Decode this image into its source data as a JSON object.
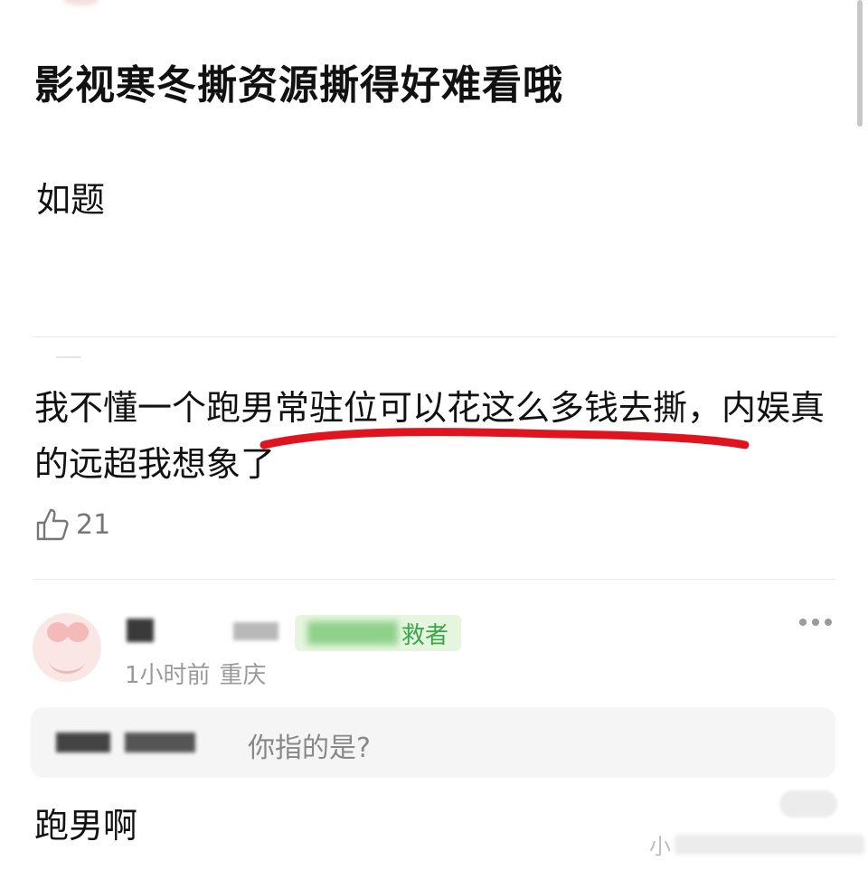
{
  "post": {
    "title": "影视寒冬撕资源撕得好难看哦",
    "body": "如题"
  },
  "comment": {
    "text": "我不懂一个跑男常驻位可以花这么多钱去撕，内娱真的远超我想象了",
    "likes": "21",
    "underline_color": "#e0141e"
  },
  "reply": {
    "badge_visible_text": "救者",
    "time": "1小时前",
    "location": "重庆",
    "quote_text": "你指的是?",
    "text": "跑男啊"
  },
  "watermark": {
    "visible_char": "小"
  },
  "colors": {
    "badge_text": "#3aa84a",
    "badge_bg": "#e6f6de",
    "meta": "#9a9a9a"
  }
}
